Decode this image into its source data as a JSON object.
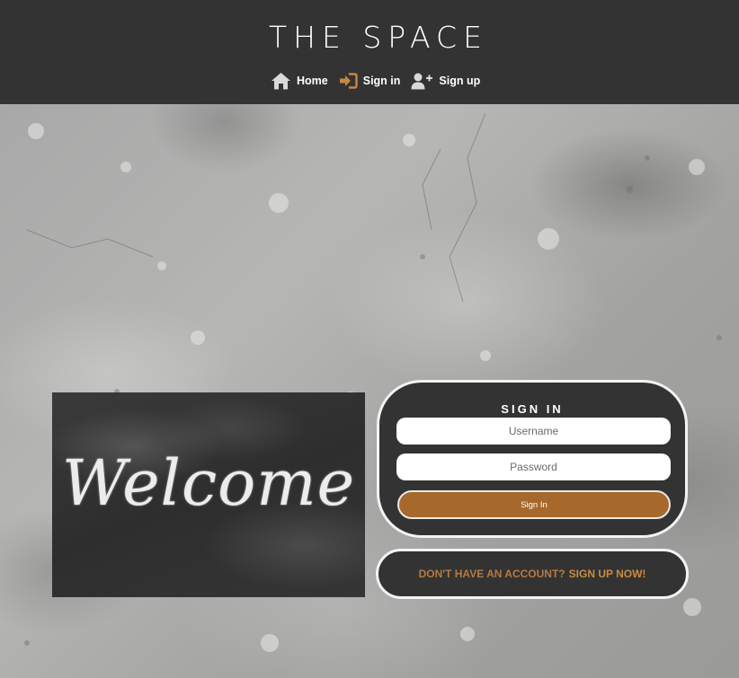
{
  "header": {
    "brand": "THE SPACE",
    "nav": [
      {
        "label": "Home",
        "icon": "home-icon"
      },
      {
        "label": "Sign in",
        "icon": "sign-in-icon"
      },
      {
        "label": "Sign up",
        "icon": "user-plus-icon"
      }
    ]
  },
  "welcome_image": {
    "text": "Welcome"
  },
  "signin": {
    "title": "SIGN IN",
    "username_placeholder": "Username",
    "password_placeholder": "Password",
    "button_label": "Sign In"
  },
  "signup": {
    "prompt": "DON'T HAVE AN ACCOUNT?",
    "link": "SIGN UP NOW!"
  },
  "colors": {
    "header_bg": "#333333",
    "accent": "#a7692b",
    "icon_accent": "#c8873f",
    "card_bg": "#333333"
  }
}
